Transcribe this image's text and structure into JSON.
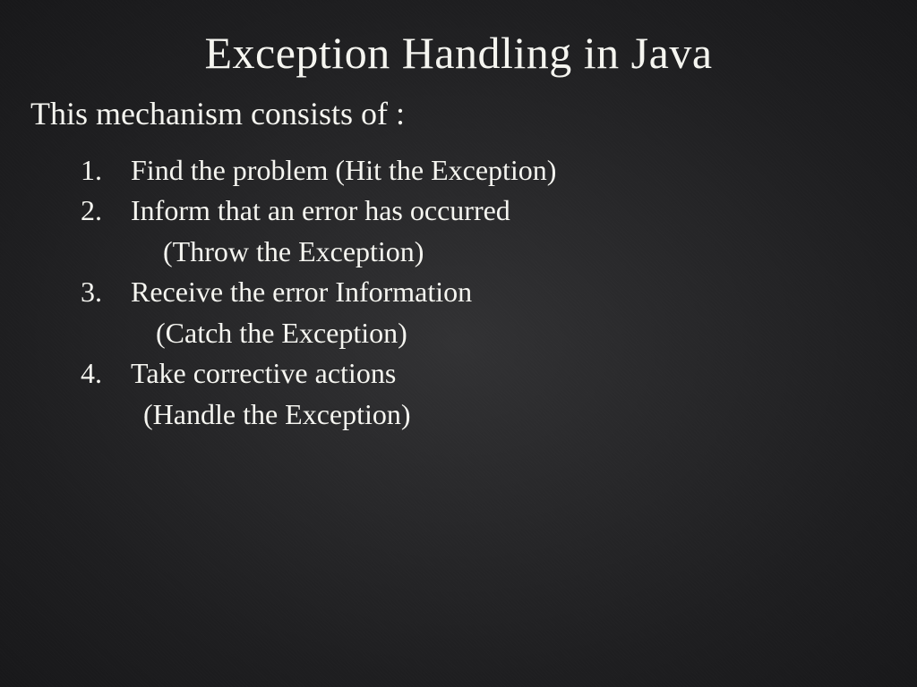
{
  "title": "Exception Handling in Java",
  "subtitle": "This mechanism consists of :",
  "items": [
    {
      "num": "1.",
      "main": "Find the problem (Hit the Exception)"
    },
    {
      "num": "2.",
      "main": "Inform that an error has occurred",
      "sub": "(Throw the Exception)"
    },
    {
      "num": "3.",
      "main": "Receive the error Information",
      "sub": "(Catch the Exception)"
    },
    {
      "num": "4.",
      "main": "Take corrective actions",
      "sub": "(Handle the Exception)"
    }
  ]
}
